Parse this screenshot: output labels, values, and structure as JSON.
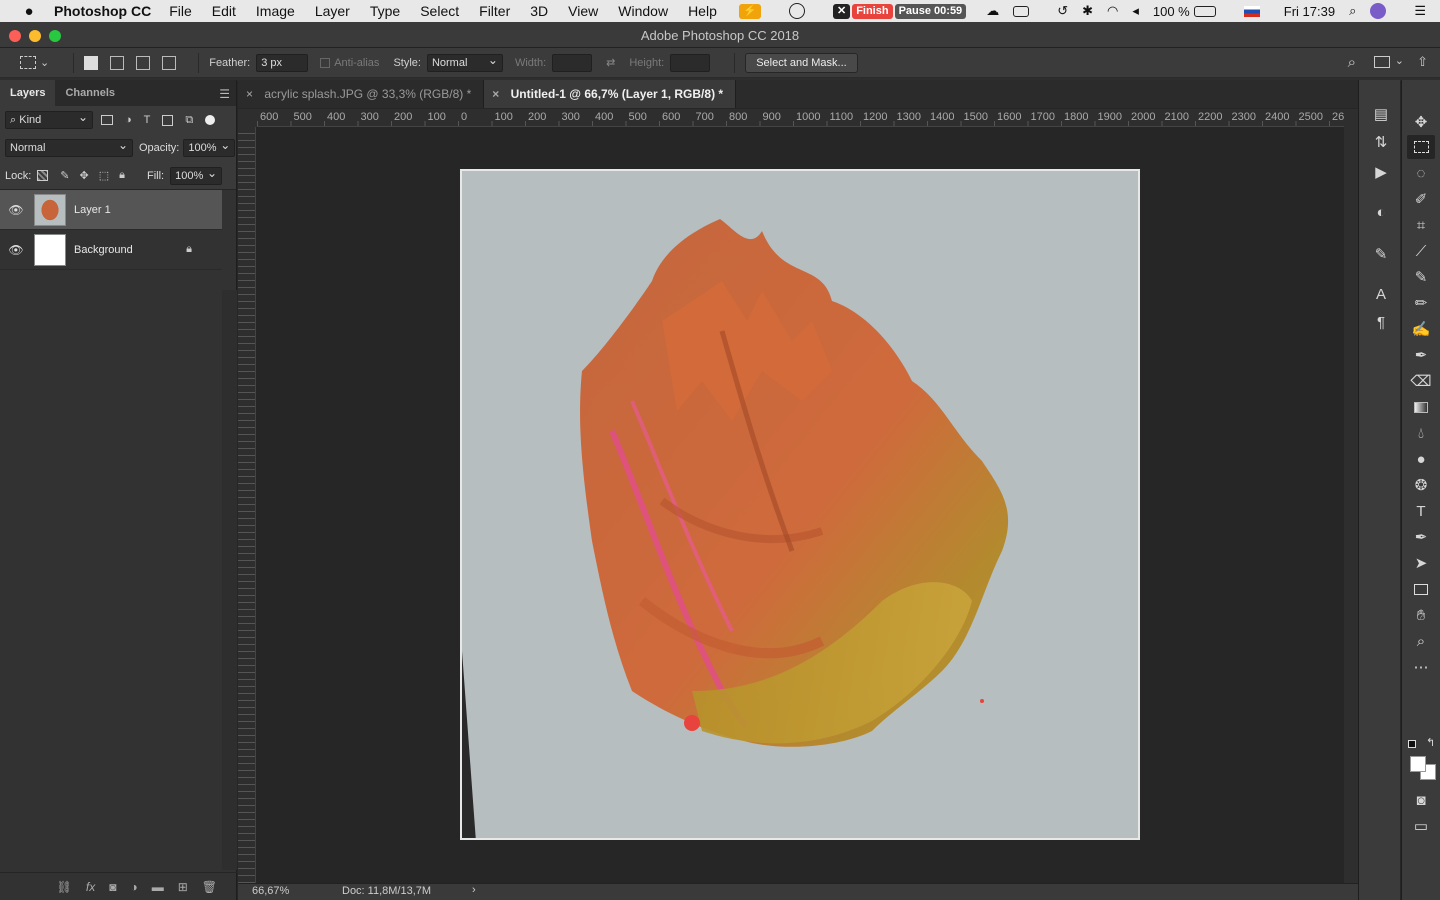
{
  "menubar": {
    "app_name": "Photoshop CC",
    "items": [
      "File",
      "Edit",
      "Image",
      "Layer",
      "Type",
      "Select",
      "Filter",
      "3D",
      "View",
      "Window",
      "Help"
    ],
    "finish_label": "Finish",
    "pause_label": "Pause 00:59",
    "battery": "100 %",
    "clock": "Fri 17:39"
  },
  "window": {
    "title": "Adobe Photoshop CC 2018"
  },
  "options": {
    "feather_label": "Feather:",
    "feather_value": "3 px",
    "antialias_label": "Anti-alias",
    "style_label": "Style:",
    "style_value": "Normal",
    "width_label": "Width:",
    "height_label": "Height:",
    "select_mask_label": "Select and Mask..."
  },
  "layers_panel": {
    "tabs": [
      "Layers",
      "Channels"
    ],
    "kind_label": "Kind",
    "blend_mode": "Normal",
    "opacity_label": "Opacity:",
    "opacity_value": "100%",
    "lock_label": "Lock:",
    "fill_label": "Fill:",
    "fill_value": "100%",
    "layers": [
      {
        "name": "Layer 1",
        "selected": true,
        "locked": false
      },
      {
        "name": "Background",
        "selected": false,
        "locked": true
      }
    ]
  },
  "documents": {
    "tabs": [
      {
        "label": "acrylic splash.JPG @ 33,3% (RGB/8) *",
        "active": false
      },
      {
        "label": "Untitled-1 @ 66,7% (Layer 1, RGB/8) *",
        "active": true
      }
    ]
  },
  "ruler": {
    "ticks": [
      "600",
      "500",
      "400",
      "300",
      "200",
      "100",
      "0",
      "100",
      "200",
      "300",
      "400",
      "500",
      "600",
      "700",
      "800",
      "900",
      "1000",
      "1100",
      "1200",
      "1300",
      "1400",
      "1500",
      "1600",
      "1700",
      "1800",
      "1900",
      "2000",
      "2100",
      "2200",
      "2300",
      "2400",
      "2500",
      "26"
    ]
  },
  "status": {
    "zoom": "66,67%",
    "doc_size": "Doc: 11,8M/13,7M"
  },
  "colors": {
    "accent_red": "#e8433d",
    "paint_orange": "#c8643a",
    "paint_gold": "#b7992e",
    "paint_pink": "#e24c8c",
    "canvas_bg": "#b6bec0"
  },
  "tools": [
    "move-icon",
    "marquee-icon",
    "lasso-icon",
    "quick-select-icon",
    "crop-icon",
    "eyedropper-icon",
    "healing-brush-icon",
    "brush-icon",
    "clone-stamp-icon",
    "history-brush-icon",
    "eraser-icon",
    "gradient-icon",
    "blur-icon",
    "dodge-icon",
    "pen-icon",
    "type-icon",
    "path-select-icon",
    "rectangle-icon",
    "hand-icon",
    "zoom-icon"
  ]
}
